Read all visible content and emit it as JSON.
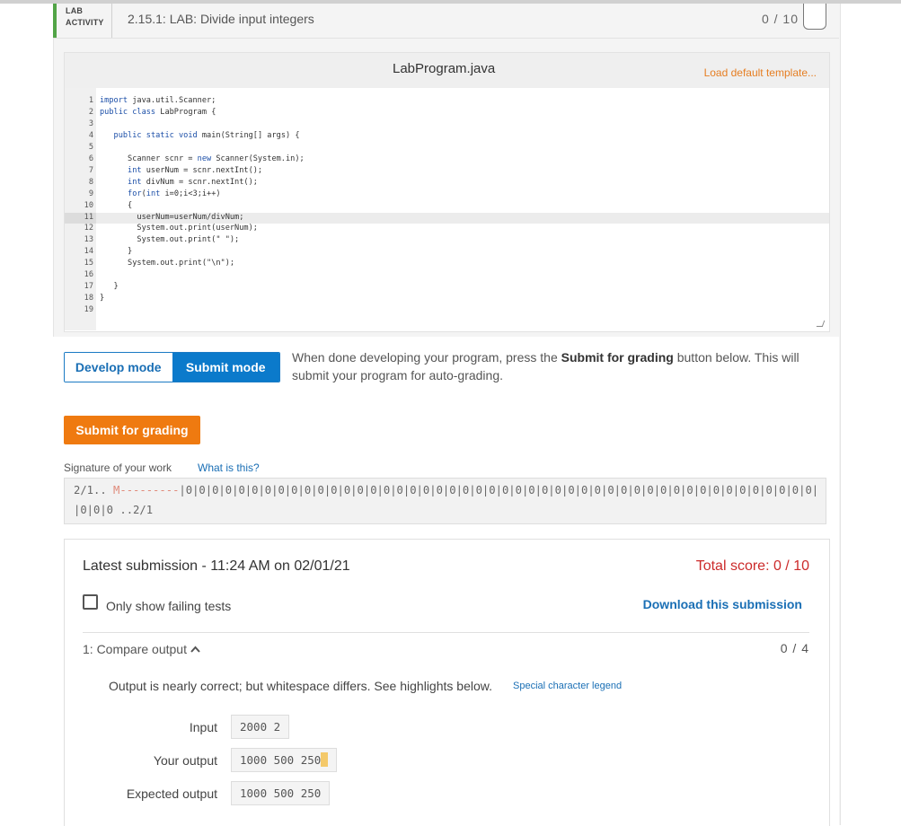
{
  "header": {
    "tag_line1": "LAB",
    "tag_line2": "ACTIVITY",
    "title": "2.15.1: LAB: Divide input integers",
    "score": "0 / 10"
  },
  "editor": {
    "file_name": "LabProgram.java",
    "load_template": "Load default template...",
    "lines": [
      {
        "n": "1",
        "code": "import java.util.Scanner;"
      },
      {
        "n": "2",
        "code": "public class LabProgram {"
      },
      {
        "n": "3",
        "code": ""
      },
      {
        "n": "4",
        "code": "   public static void main(String[] args) {"
      },
      {
        "n": "5",
        "code": ""
      },
      {
        "n": "6",
        "code": "      Scanner scnr = new Scanner(System.in);"
      },
      {
        "n": "7",
        "code": "      int userNum = scnr.nextInt();"
      },
      {
        "n": "8",
        "code": "      int divNum = scnr.nextInt();"
      },
      {
        "n": "9",
        "code": "      for(int i=0;i<3;i++)"
      },
      {
        "n": "10",
        "code": "      {"
      },
      {
        "n": "11",
        "code": "        userNum=userNum/divNum;"
      },
      {
        "n": "12",
        "code": "        System.out.print(userNum);"
      },
      {
        "n": "13",
        "code": "        System.out.print(\" \");"
      },
      {
        "n": "14",
        "code": "      }"
      },
      {
        "n": "15",
        "code": "      System.out.print(\"\\n\");"
      },
      {
        "n": "16",
        "code": ""
      },
      {
        "n": "17",
        "code": "   }"
      },
      {
        "n": "18",
        "code": "}"
      },
      {
        "n": "19",
        "code": ""
      }
    ]
  },
  "modes": {
    "develop": "Develop mode",
    "submit": "Submit mode",
    "desc_pre": "When done developing your program, press the ",
    "desc_bold": "Submit for grading",
    "desc_post": " button below. This will submit your program for auto-grading."
  },
  "submit_button": "Submit for grading",
  "signature": {
    "label": "Signature of your work",
    "link": "What is this?",
    "prefix": "2/1.. ",
    "marker": "M---------",
    "body": "|0|0|0|0|0|0|0|0|0|0|0|0|0|0|0|0|0|0|0|0|0|0|0|0|0|0|0|0|0|0|0|0|0|0|0|0|0|0|0|0|0|0|0|0|0|0|0|0|0|0|0|0|0|0|0|0|0|0|0|0|0",
    "line2": "|0|0|0 ..2/1"
  },
  "submission": {
    "latest": "Latest submission - 11:24 AM on 02/01/21",
    "total": "Total score: 0 / 10",
    "only_failing": "Only show failing tests",
    "download": "Download this submission",
    "test_title": "1: Compare output",
    "test_score": "0 / 4",
    "feedback": "Output is nearly correct; but whitespace differs. See highlights below.",
    "legend_link": "Special character legend",
    "input_label": "Input",
    "input_value": "2000 2",
    "your_label": "Your output",
    "your_value": "1000 500 250",
    "expected_label": "Expected output",
    "expected_value": "1000 500 250"
  }
}
